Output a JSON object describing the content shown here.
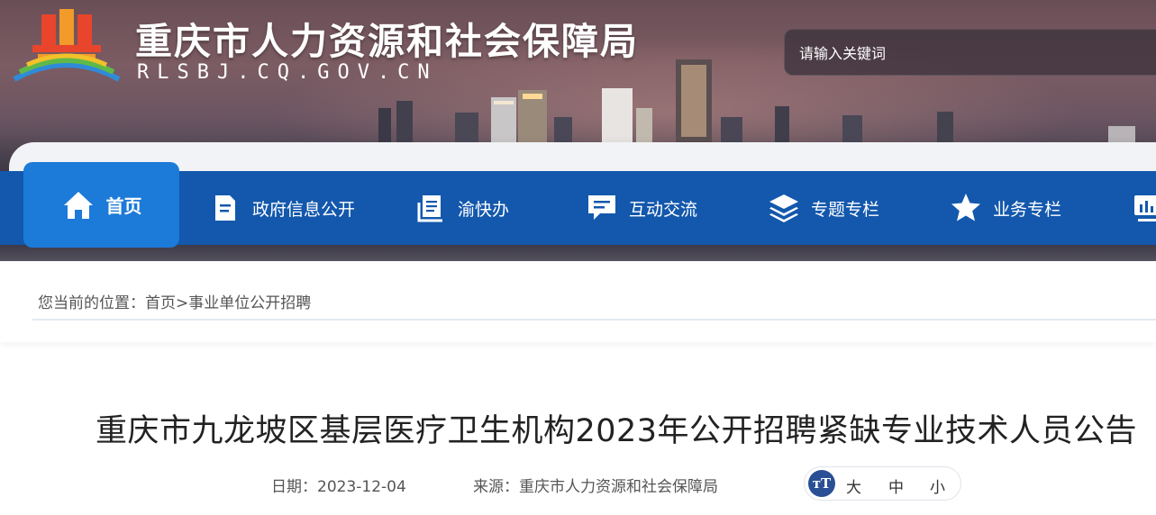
{
  "header": {
    "site_title": "重庆市人力资源和社会保障局",
    "site_domain": "RLSBJ.CQ.GOV.CN",
    "search_placeholder": "请输入关键词"
  },
  "nav": {
    "items": [
      {
        "label": "首页",
        "icon": "home-icon",
        "active": true
      },
      {
        "label": "政府信息公开",
        "icon": "document-icon"
      },
      {
        "label": "渝快办",
        "icon": "book-icon"
      },
      {
        "label": "互动交流",
        "icon": "chat-icon"
      },
      {
        "label": "专题专栏",
        "icon": "layers-icon"
      },
      {
        "label": "业务专栏",
        "icon": "star-icon"
      },
      {
        "label": "",
        "icon": "chart-icon"
      }
    ]
  },
  "breadcrumb": {
    "prefix": "您当前的位置：",
    "home": "首页",
    "separator": ">",
    "current": "事业单位公开招聘"
  },
  "article": {
    "title": "重庆市九龙坡区基层医疗卫生机构2023年公开招聘紧缺专业技术人员公告",
    "date_label": "日期：",
    "date": "2023-12-04",
    "source_label": "来源：",
    "source": "重庆市人力资源和社会保障局",
    "font_sizes": [
      "大",
      "中",
      "小"
    ]
  },
  "colors": {
    "nav_bg": "#1358ac",
    "nav_active": "#1c7ad8",
    "font_icon_bg": "#2a4f94"
  }
}
